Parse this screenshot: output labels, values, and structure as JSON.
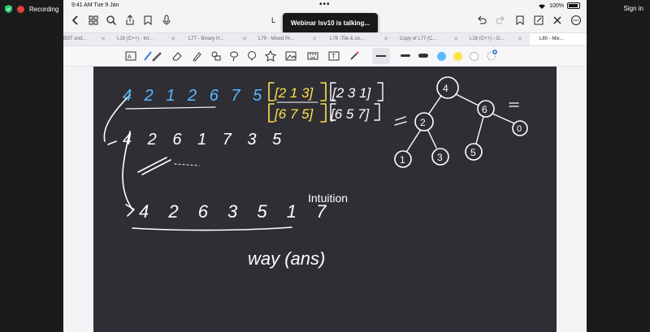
{
  "zoom": {
    "recording_label": "Recording",
    "signin_label": "Sign in"
  },
  "status_bar": {
    "time": "9:41 AM   Tue 9 Jan",
    "dots": "•••",
    "battery": "100%"
  },
  "doc_title": "L",
  "toast": "Webinar lsv10 is talking...",
  "tabs": [
    {
      "label": "BST and..."
    },
    {
      "label": "L16 (C++) - Int..."
    },
    {
      "label": "L77 - Binary H..."
    },
    {
      "label": "L79 - Mixed Pr..."
    },
    {
      "label": "L78 -Tile & so..."
    },
    {
      "label": "Copy of L77 (C..."
    },
    {
      "label": "L18 (C++) - O..."
    },
    {
      "label": "L80 - Mix..."
    }
  ],
  "canvas": {
    "intuition_label": "Intuition",
    "handwriting": {
      "row1": "4 2 1 2 6 7 5",
      "row2": "4 2 6 1 7 3 5",
      "row3": "4 2 6 3 5 1 7",
      "bracket1": "[2 1 3]",
      "bracket2": "[6 7 5]",
      "bracket3": "[2 3 1]",
      "bracket4": "[6 5 7]",
      "note": "way (ans)",
      "tree_nodes": [
        "4",
        "2",
        "6",
        "1",
        "3",
        "5",
        "0"
      ]
    }
  },
  "colors": {
    "canvas_bg": "#2f2e35",
    "accent_yellow": "#ffe14a",
    "accent_blue": "#5ab9ff"
  }
}
